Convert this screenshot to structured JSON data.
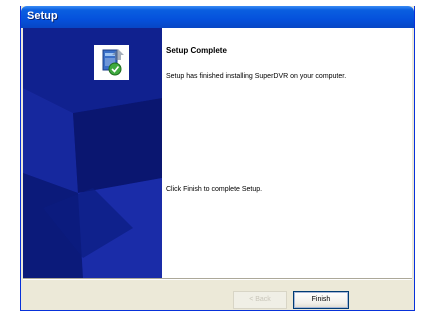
{
  "window": {
    "title": "Setup"
  },
  "page": {
    "heading": "Setup Complete",
    "message": "Setup has finished installing SuperDVR on your computer.",
    "instruction": "Click Finish to complete Setup."
  },
  "buttons": {
    "back": "< Back",
    "finish": "Finish"
  },
  "colors": {
    "titlebar": "#0551dc",
    "side_panel": "#0e1f8c",
    "dialog_bg": "#ece9d8"
  }
}
